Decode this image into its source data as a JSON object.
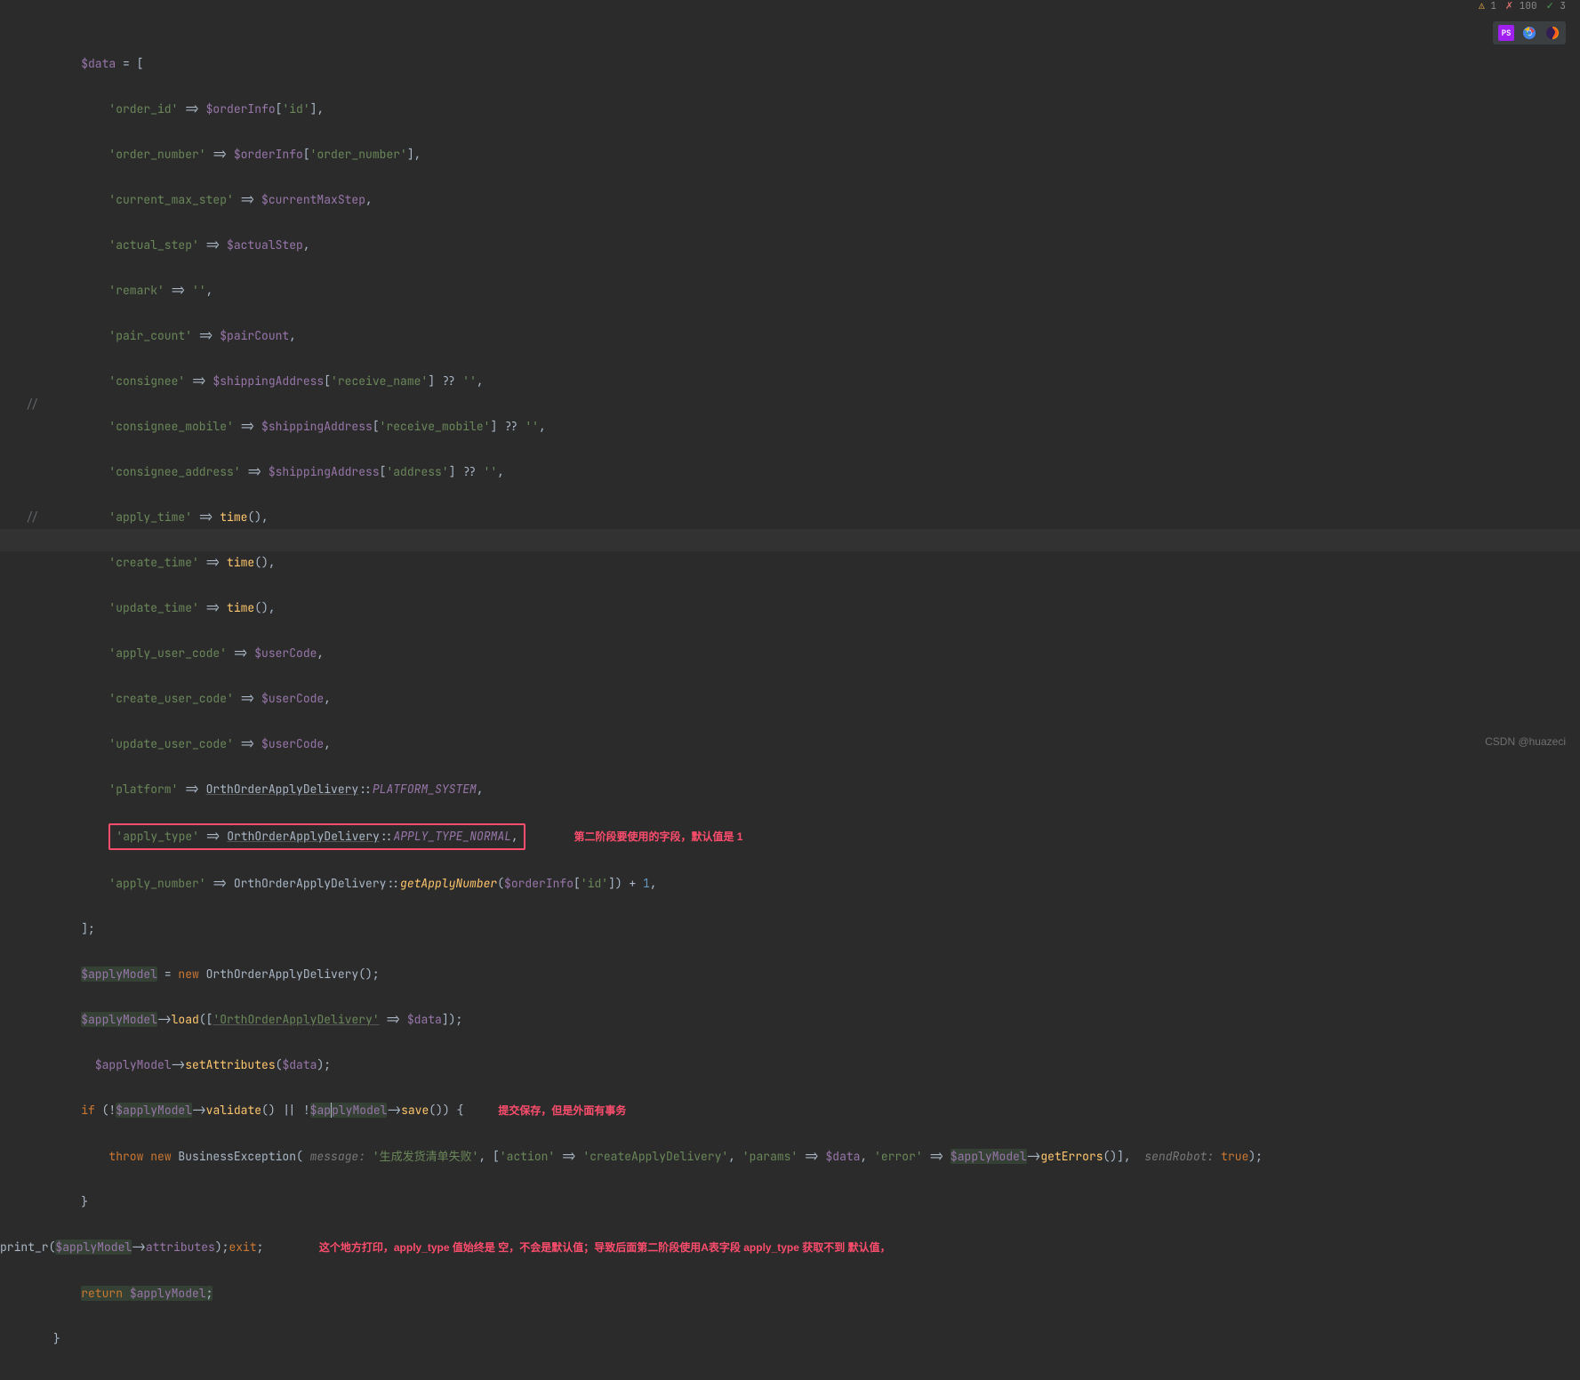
{
  "status": {
    "warn_icon": "⚠",
    "warn": "1",
    "err_icon": "✗",
    "err": "100",
    "ok_icon": "✓",
    "ok": "3"
  },
  "toolbar": {
    "ps": "PS",
    "chrome": "chrome-icon",
    "firefox": "firefox-icon"
  },
  "watermark": "CSDN @huazeci",
  "gutter": {
    "c1": "//",
    "c2": "//"
  },
  "ann": {
    "a1": "第二阶段要使用的字段，默认值是 1",
    "a2": "提交保存，但是外面有事务",
    "a3": "这个地方打印，apply_type 值始终是 空，不会是默认值；导致后面第二阶段使用A表字段 apply_type 获取不到 默认值，"
  },
  "code": {
    "l1_a": "$data",
    "l1_b": " = [",
    "l2_a": "'order_id'",
    "l2_b": " => ",
    "l2_c": "$orderInfo",
    "l2_d": "[",
    "l2_e": "'id'",
    "l2_f": "],",
    "l3_a": "'order_number'",
    "l3_b": " => ",
    "l3_c": "$orderInfo",
    "l3_d": "[",
    "l3_e": "'order_number'",
    "l3_f": "],",
    "l4_a": "'current_max_step'",
    "l4_b": " => ",
    "l4_c": "$currentMaxStep",
    "l4_d": ",",
    "l5_a": "'actual_step'",
    "l5_b": " => ",
    "l5_c": "$actualStep",
    "l5_d": ",",
    "l6_a": "'remark'",
    "l6_b": " => ",
    "l6_c": "''",
    "l6_d": ",",
    "l7_a": "'pair_count'",
    "l7_b": " => ",
    "l7_c": "$pairCount",
    "l7_d": ",",
    "l8_a": "'consignee'",
    "l8_b": " => ",
    "l8_c": "$shippingAddress",
    "l8_d": "[",
    "l8_e": "'receive_name'",
    "l8_f": "] ?? ",
    "l8_g": "''",
    "l8_h": ",",
    "l9_a": "'consignee_mobile'",
    "l9_b": " => ",
    "l9_c": "$shippingAddress",
    "l9_d": "[",
    "l9_e": "'receive_mobile'",
    "l9_f": "] ?? ",
    "l9_g": "''",
    "l9_h": ",",
    "l10_a": "'consignee_address'",
    "l10_b": " => ",
    "l10_c": "$shippingAddress",
    "l10_d": "[",
    "l10_e": "'address'",
    "l10_f": "] ?? ",
    "l10_g": "''",
    "l10_h": ",",
    "l11_a": "'apply_time'",
    "l11_b": " => ",
    "l11_c": "time",
    "l11_d": "(),",
    "l12_a": "'create_time'",
    "l12_b": " => ",
    "l12_c": "time",
    "l12_d": "(),",
    "l13_a": "'update_time'",
    "l13_b": " => ",
    "l13_c": "time",
    "l13_d": "(),",
    "l14_a": "'apply_user_code'",
    "l14_b": " => ",
    "l14_c": "$userCode",
    "l14_d": ",",
    "l15_a": "'create_user_code'",
    "l15_b": " => ",
    "l15_c": "$userCode",
    "l15_d": ",",
    "l16_a": "'update_user_code'",
    "l16_b": " => ",
    "l16_c": "$userCode",
    "l16_d": ",",
    "l17_a": "'platform'",
    "l17_b": " => ",
    "l17_c": "OrthOrderApplyDelivery",
    "l17_d": "::",
    "l17_e": "PLATFORM_SYSTEM",
    "l17_f": ",",
    "l18_a": "'apply_type'",
    "l18_b": " => ",
    "l18_c": "OrthOrderApplyDelivery",
    "l18_d": "::",
    "l18_e": "APPLY_TYPE_NORMAL",
    "l18_f": ",",
    "l19_a": "'apply_number'",
    "l19_b": " => ",
    "l19_c": "OrthOrderApplyDelivery::",
    "l19_d": "getApplyNumber",
    "l19_e": "(",
    "l19_f": "$orderInfo",
    "l19_g": "[",
    "l19_h": "'id'",
    "l19_i": "]) + ",
    "l19_j": "1",
    "l19_k": ",",
    "l20": "];",
    "l21_a": "$applyModel",
    "l21_b": " = ",
    "l21_c": "new ",
    "l21_d": "OrthOrderApplyDelivery();",
    "l22_a": "$applyModel",
    "l22_b": "->",
    "l22_c": "load",
    "l22_d": "([",
    "l22_e": "'OrthOrderApplyDelivery'",
    "l22_f": " => ",
    "l22_g": "$data",
    "l22_h": "]);",
    "l23_a": "$applyModel",
    "l23_b": "->",
    "l23_c": "setAttributes",
    "l23_d": "(",
    "l23_e": "$data",
    "l23_f": ");",
    "l24_a": "if ",
    "l24_b": "(!",
    "l24_c": "$applyModel",
    "l24_d": "->",
    "l24_e": "validate",
    "l24_f": "() || !",
    "l24_g": "$ap",
    "l24_g2": "plyModel",
    "l24_h": "->",
    "l24_i": "save",
    "l24_j": "()) {",
    "l25_a": "throw ",
    "l25_b": "new ",
    "l25_c": "BusinessException( ",
    "l25_d": "message: ",
    "l25_e": "'生成发货清单失败'",
    "l25_f": ", [",
    "l25_g": "'action'",
    "l25_h": " => ",
    "l25_i": "'createApplyDelivery'",
    "l25_j": ", ",
    "l25_k": "'params'",
    "l25_l": " => ",
    "l25_m": "$data",
    "l25_n": ", ",
    "l25_o": "'error'",
    "l25_p": " => ",
    "l25_q": "$applyModel",
    "l25_r": "->",
    "l25_s": "getErrors",
    "l25_t": "()],  ",
    "l25_u": "sendRobot: ",
    "l25_v": "true",
    "l25_w": ");",
    "l26": "}",
    "l27_a": "print_r(",
    "l27_b": "$applyModel",
    "l27_c": "->",
    "l27_d": "attributes",
    "l27_e": ");",
    "l27_f": "exit",
    "l27_g": ";",
    "l28_a": "return ",
    "l28_b": "$applyModel",
    "l28_c": ";",
    "l29": "}"
  }
}
